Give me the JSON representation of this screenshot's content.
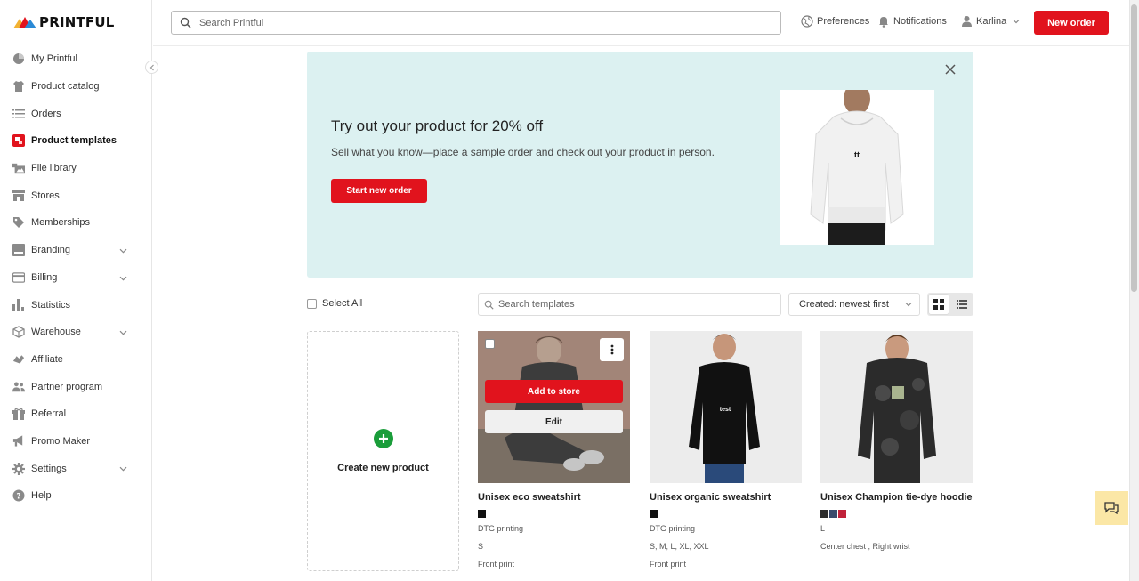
{
  "brand": {
    "name": "PRINTFUL",
    "accent": "#e1131d"
  },
  "sidebar": {
    "items": [
      {
        "label": "My Printful",
        "icon": "pie-chart-icon"
      },
      {
        "label": "Product catalog",
        "icon": "tshirt-icon"
      },
      {
        "label": "Orders",
        "icon": "list-icon"
      },
      {
        "label": "Product templates",
        "icon": "templates-icon",
        "active": true
      },
      {
        "label": "File library",
        "icon": "images-icon"
      },
      {
        "label": "Stores",
        "icon": "store-icon"
      },
      {
        "label": "Memberships",
        "icon": "tag-icon"
      },
      {
        "label": "Branding",
        "icon": "branding-icon",
        "expandable": true
      },
      {
        "label": "Billing",
        "icon": "credit-card-icon",
        "expandable": true
      },
      {
        "label": "Statistics",
        "icon": "bar-chart-icon"
      },
      {
        "label": "Warehouse",
        "icon": "box-icon",
        "expandable": true
      },
      {
        "label": "Affiliate",
        "icon": "handshake-icon"
      },
      {
        "label": "Partner program",
        "icon": "people-icon"
      },
      {
        "label": "Referral",
        "icon": "gift-icon"
      },
      {
        "label": "Promo Maker",
        "icon": "megaphone-icon"
      },
      {
        "label": "Settings",
        "icon": "gear-icon",
        "expandable": true
      },
      {
        "label": "Help",
        "icon": "help-icon"
      }
    ]
  },
  "topbar": {
    "search_placeholder": "Search Printful",
    "preferences": "Preferences",
    "notifications": "Notifications",
    "user": "Karlina",
    "new_order": "New order"
  },
  "banner": {
    "title": "Try out your product for 20% off",
    "subtitle": "Sell what you know—place a sample order and check out your product in person.",
    "cta": "Start new order",
    "print_text": "tt",
    "background": "#dcf1f1"
  },
  "templates": {
    "select_all": "Select All",
    "search_placeholder": "Search templates",
    "sort": "Created: newest first",
    "create_label": "Create new product",
    "cards": [
      {
        "name": "Unisex eco sweatshirt",
        "colors": [
          "#111111"
        ],
        "technique": "DTG printing",
        "sizes": "S",
        "placement": "Front print",
        "add_to_store": "Add to store",
        "edit": "Edit"
      },
      {
        "name": "Unisex organic sweatshirt",
        "colors": [
          "#111111"
        ],
        "technique": "DTG printing",
        "sizes": "S, M, L, XL, XXL",
        "placement": "Front print",
        "print_text": "test"
      },
      {
        "name": "Unisex Champion tie-dye hoodie",
        "colors": [
          "#2d2d2d",
          "#3a4a6b",
          "#c0223a"
        ],
        "technique": "L",
        "sizes": "Center chest , Right wrist"
      }
    ]
  }
}
